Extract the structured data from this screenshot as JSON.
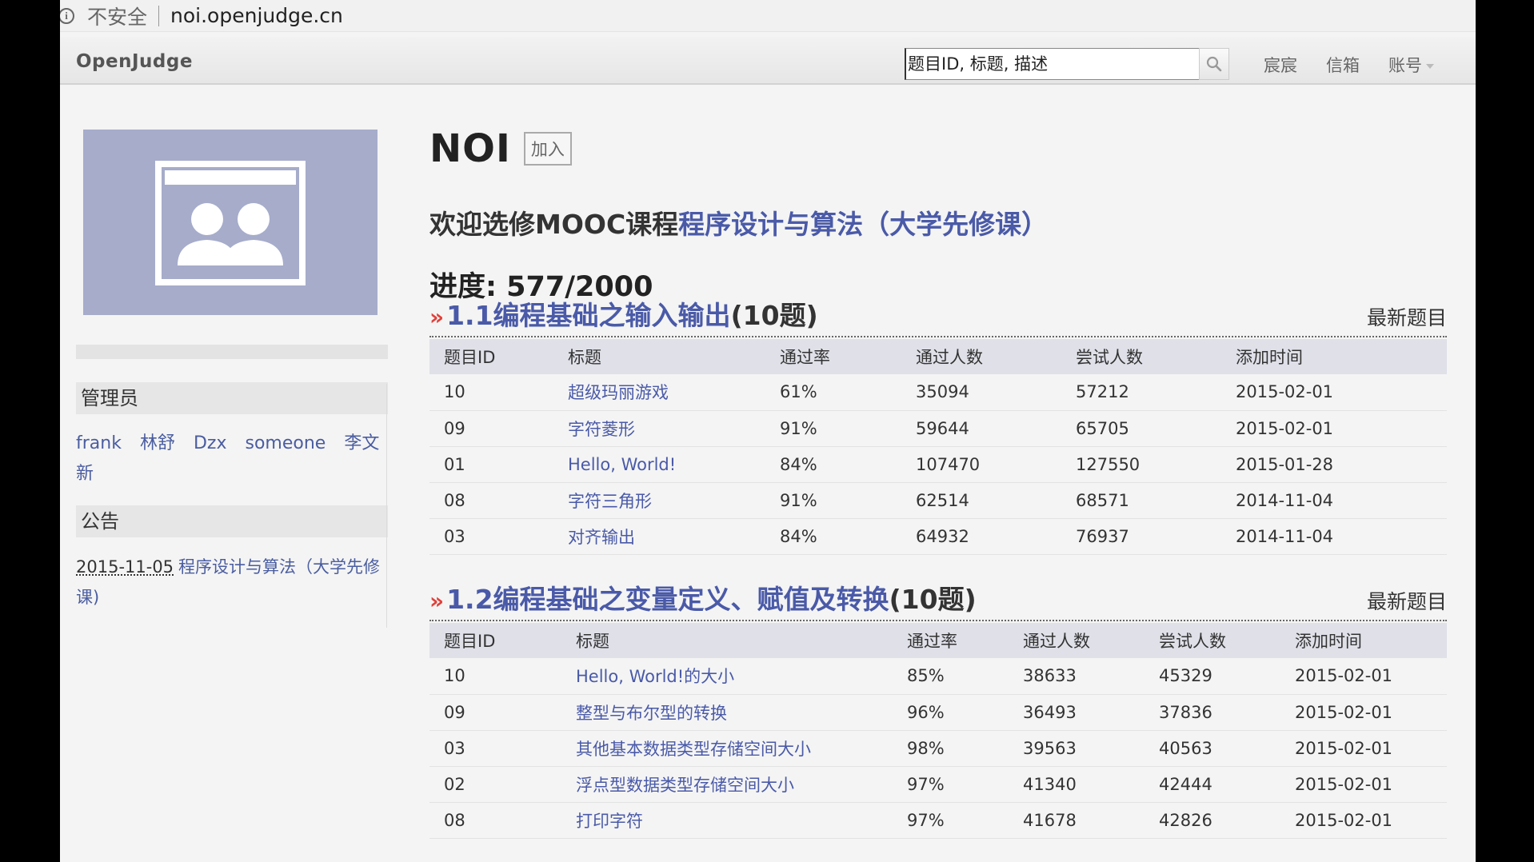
{
  "browser": {
    "insecure_label": "不安全",
    "url": "noi.openjudge.cn"
  },
  "topbar": {
    "brand": "OpenJudge",
    "search_placeholder": "题目ID, 标题, 描述",
    "links": [
      "宸宸",
      "信箱",
      "账号"
    ]
  },
  "sidebar": {
    "admins_title": "管理员",
    "admins": [
      "frank",
      "林舒",
      "Dzx",
      "someone",
      "李文新"
    ],
    "notice_title": "公告",
    "notice": {
      "date": "2015-11-05",
      "text": "程序设计与算法（大学先修课)"
    }
  },
  "main": {
    "group_name": "NOI",
    "join_label": "加入",
    "welcome_prefix": "欢迎选修MOOC课程",
    "welcome_link": "程序设计与算法（大学先修课）",
    "progress": "进度: 577/2000",
    "latest_label": "最新题目",
    "columns": [
      "题目ID",
      "标题",
      "通过率",
      "通过人数",
      "尝试人数",
      "添加时间"
    ],
    "sections": [
      {
        "title": "1.1编程基础之输入输出",
        "count": "(10题)",
        "rows": [
          [
            "10",
            "超级玛丽游戏",
            "61%",
            "35094",
            "57212",
            "2015-02-01"
          ],
          [
            "09",
            "字符菱形",
            "91%",
            "59644",
            "65705",
            "2015-02-01"
          ],
          [
            "01",
            "Hello, World!",
            "84%",
            "107470",
            "127550",
            "2015-01-28"
          ],
          [
            "08",
            "字符三角形",
            "91%",
            "62514",
            "68571",
            "2014-11-04"
          ],
          [
            "03",
            "对齐输出",
            "84%",
            "64932",
            "76937",
            "2014-11-04"
          ]
        ]
      },
      {
        "title": "1.2编程基础之变量定义、赋值及转换",
        "count": "(10题)",
        "rows": [
          [
            "10",
            "Hello, World!的大小",
            "85%",
            "38633",
            "45329",
            "2015-02-01"
          ],
          [
            "09",
            "整型与布尔型的转换",
            "96%",
            "36493",
            "37836",
            "2015-02-01"
          ],
          [
            "03",
            "其他基本数据类型存储空间大小",
            "98%",
            "39563",
            "40563",
            "2015-02-01"
          ],
          [
            "02",
            "浮点型数据类型存储空间大小",
            "97%",
            "41340",
            "42444",
            "2015-02-01"
          ],
          [
            "08",
            "打印字符",
            "97%",
            "41678",
            "42826",
            "2015-02-01"
          ]
        ]
      }
    ]
  }
}
